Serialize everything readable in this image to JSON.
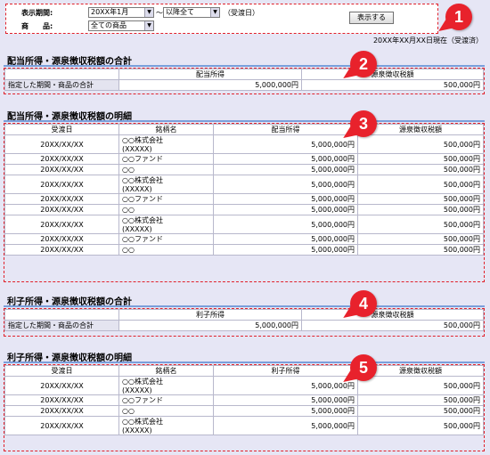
{
  "filter": {
    "period_label": "表示期間:",
    "period_from": "20XX年1月",
    "tilde": "〜",
    "period_to": "以降全て",
    "period_note": "（受渡日）",
    "product_label": "商　　品:",
    "product_value": "全ての商品",
    "show_button": "表示する"
  },
  "as_of": "20XX年XX月XX日現在（受渡済）",
  "markers": [
    "1",
    "2",
    "3",
    "4",
    "5"
  ],
  "dividend_total": {
    "title": "配当所得・源泉徴収税額の合計",
    "headers": [
      "配当所得",
      "源泉徴収税額"
    ],
    "row_label": "指定した期間・商品の合計",
    "income": "5,000,000円",
    "tax": "500,000円"
  },
  "dividend_detail": {
    "title": "配当所得・源泉徴収税額の明細",
    "headers": [
      "受渡日",
      "銘柄名",
      "配当所得",
      "源泉徴収税額"
    ],
    "rows": [
      {
        "date": "20XX/XX/XX",
        "name1": "○○株式会社",
        "name2": "(XXXXX)",
        "income": "5,000,000円",
        "tax": "500,000円"
      },
      {
        "date": "20XX/XX/XX",
        "name1": "○○ファンド",
        "name2": "",
        "income": "5,000,000円",
        "tax": "500,000円"
      },
      {
        "date": "20XX/XX/XX",
        "name1": "○○",
        "name2": "",
        "income": "5,000,000円",
        "tax": "500,000円"
      },
      {
        "date": "20XX/XX/XX",
        "name1": "○○株式会社",
        "name2": "(XXXXX)",
        "income": "5,000,000円",
        "tax": "500,000円"
      },
      {
        "date": "20XX/XX/XX",
        "name1": "○○ファンド",
        "name2": "",
        "income": "5,000,000円",
        "tax": "500,000円"
      },
      {
        "date": "20XX/XX/XX",
        "name1": "○○",
        "name2": "",
        "income": "5,000,000円",
        "tax": "500,000円"
      },
      {
        "date": "20XX/XX/XX",
        "name1": "○○株式会社",
        "name2": "(XXXXX)",
        "income": "5,000,000円",
        "tax": "500,000円"
      },
      {
        "date": "20XX/XX/XX",
        "name1": "○○ファンド",
        "name2": "",
        "income": "5,000,000円",
        "tax": "500,000円"
      },
      {
        "date": "20XX/XX/XX",
        "name1": "○○",
        "name2": "",
        "income": "5,000,000円",
        "tax": "500,000円"
      }
    ]
  },
  "interest_total": {
    "title": "利子所得・源泉徴収税額の合計",
    "headers": [
      "利子所得",
      "源泉徴収税額"
    ],
    "row_label": "指定した期間・商品の合計",
    "income": "5,000,000円",
    "tax": "500,000円"
  },
  "interest_detail": {
    "title": "利子所得・源泉徴収税額の明細",
    "headers": [
      "受渡日",
      "銘柄名",
      "利子所得",
      "源泉徴収税額"
    ],
    "rows": [
      {
        "date": "20XX/XX/XX",
        "name1": "○○株式会社",
        "name2": "(XXXXX)",
        "income": "5,000,000円",
        "tax": "500,000円"
      },
      {
        "date": "20XX/XX/XX",
        "name1": "○○ファンド",
        "name2": "",
        "income": "5,000,000円",
        "tax": "500,000円"
      },
      {
        "date": "20XX/XX/XX",
        "name1": "○○",
        "name2": "",
        "income": "5,000,000円",
        "tax": "500,000円"
      },
      {
        "date": "20XX/XX/XX",
        "name1": "○○株式会社",
        "name2": "(XXXXX)",
        "income": "5,000,000円",
        "tax": "500,000円"
      }
    ]
  }
}
